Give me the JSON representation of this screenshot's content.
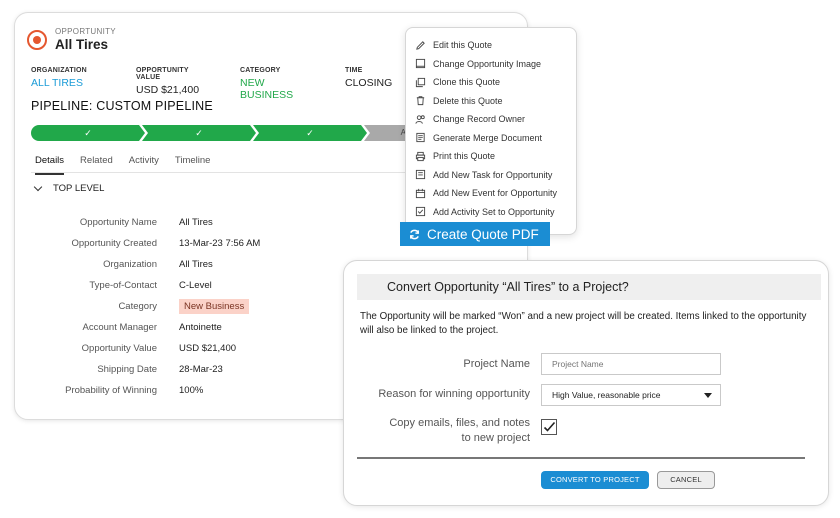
{
  "opportunity": {
    "type_label": "OPPORTUNITY",
    "name": "All Tires",
    "meta": [
      {
        "label": "ORGANIZATION",
        "value": "ALL TIRES"
      },
      {
        "label": "OPPORTUNITY VALUE",
        "value": "USD $21,400"
      },
      {
        "label": "CATEGORY",
        "value": "NEW BUSINESS"
      },
      {
        "label": "TIME",
        "value": "CLOSING"
      }
    ],
    "pipeline_title": "PIPELINE: CUSTOM PIPELINE",
    "stages": [
      {
        "label": "✓",
        "state": "done"
      },
      {
        "label": "✓",
        "state": "done"
      },
      {
        "label": "✓",
        "state": "done"
      },
      {
        "label": "A",
        "state": "pending"
      }
    ],
    "tabs": [
      "Details",
      "Related",
      "Activity",
      "Timeline"
    ],
    "active_tab": "Details",
    "section_title": "TOP LEVEL",
    "fields": [
      {
        "label": "Opportunity Name",
        "value": "All Tires"
      },
      {
        "label": "Opportunity Created",
        "value": "13-Mar-23 7:56 AM"
      },
      {
        "label": "Organization",
        "value": "All Tires"
      },
      {
        "label": "Type-of-Contact",
        "value": "C-Level"
      },
      {
        "label": "Category",
        "value": "New Business"
      },
      {
        "label": "Account Manager",
        "value": "Antoinette"
      },
      {
        "label": "Opportunity Value",
        "value": "USD $21,400"
      },
      {
        "label": "Shipping Date",
        "value": "28-Mar-23"
      },
      {
        "label": "Probability of Winning",
        "value": "100%"
      }
    ]
  },
  "menu": {
    "items": [
      {
        "label": "Edit this Quote",
        "icon": "pencil-icon"
      },
      {
        "label": "Change Opportunity Image",
        "icon": "image-icon"
      },
      {
        "label": "Clone this Quote",
        "icon": "copy-icon"
      },
      {
        "label": "Delete this Quote",
        "icon": "trash-icon"
      },
      {
        "label": "Change Record Owner",
        "icon": "users-icon"
      },
      {
        "label": "Generate Merge Document",
        "icon": "document-icon"
      },
      {
        "label": "Print this Quote",
        "icon": "printer-icon"
      },
      {
        "label": "Add New Task for Opportunity",
        "icon": "task-icon"
      },
      {
        "label": "Add New Event for Opportunity",
        "icon": "calendar-icon"
      },
      {
        "label": "Add Activity Set to Opportunity",
        "icon": "checkbox-icon"
      }
    ],
    "highlighted_action": "Create Quote PDF"
  },
  "dialog": {
    "title": "Convert Opportunity “All Tires” to a Project?",
    "description": "The Opportunity will be  marked “Won” and a new project will be created. Items linked to the opportunity will also be linked to the project.",
    "project_name_label": "Project Name",
    "project_name_placeholder": "Project Name",
    "reason_label": "Reason for winning opportunity",
    "reason_value": "High Value, reasonable price",
    "copy_label_line1": "Copy emails, files, and notes",
    "copy_label_line2": "to new project",
    "copy_checked": true,
    "convert_label": "CONVERT TO PROJECT",
    "cancel_label": "CANCEL"
  },
  "colors": {
    "accent_blue": "#1b8dd3",
    "link_blue": "#1a9bd7",
    "success_green": "#21a84a",
    "brand_orange": "#e5572f",
    "tag_bg": "#fbd2c8"
  }
}
